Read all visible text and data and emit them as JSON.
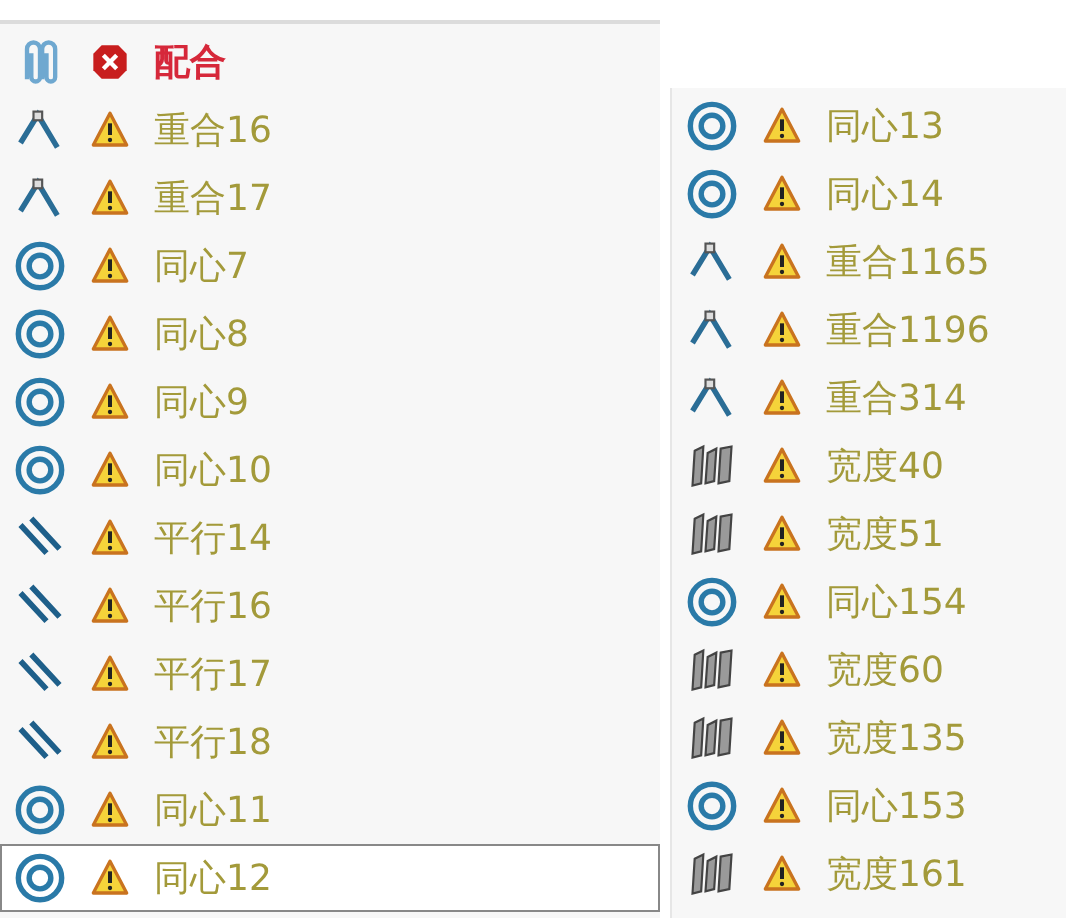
{
  "panels": [
    {
      "items": [
        {
          "kind": "mate",
          "error": true,
          "label": "配合",
          "selected": false
        },
        {
          "kind": "coincident",
          "error": false,
          "label": "重合16",
          "selected": false
        },
        {
          "kind": "coincident",
          "error": false,
          "label": "重合17",
          "selected": false
        },
        {
          "kind": "concentric",
          "error": false,
          "label": "同心7",
          "selected": false
        },
        {
          "kind": "concentric",
          "error": false,
          "label": "同心8",
          "selected": false
        },
        {
          "kind": "concentric",
          "error": false,
          "label": "同心9",
          "selected": false
        },
        {
          "kind": "concentric",
          "error": false,
          "label": "同心10",
          "selected": false
        },
        {
          "kind": "parallel",
          "error": false,
          "label": "平行14",
          "selected": false
        },
        {
          "kind": "parallel",
          "error": false,
          "label": "平行16",
          "selected": false
        },
        {
          "kind": "parallel",
          "error": false,
          "label": "平行17",
          "selected": false
        },
        {
          "kind": "parallel",
          "error": false,
          "label": "平行18",
          "selected": false
        },
        {
          "kind": "concentric",
          "error": false,
          "label": "同心11",
          "selected": false
        },
        {
          "kind": "concentric",
          "error": false,
          "label": "同心12",
          "selected": true
        }
      ]
    },
    {
      "items": [
        {
          "kind": "concentric",
          "error": false,
          "label": "同心13",
          "selected": false
        },
        {
          "kind": "concentric",
          "error": false,
          "label": "同心14",
          "selected": false
        },
        {
          "kind": "coincident",
          "error": false,
          "label": "重合1165",
          "selected": false
        },
        {
          "kind": "coincident",
          "error": false,
          "label": "重合1196",
          "selected": false
        },
        {
          "kind": "coincident",
          "error": false,
          "label": "重合314",
          "selected": false
        },
        {
          "kind": "width",
          "error": false,
          "label": "宽度40",
          "selected": false
        },
        {
          "kind": "width",
          "error": false,
          "label": "宽度51",
          "selected": false
        },
        {
          "kind": "concentric",
          "error": false,
          "label": "同心154",
          "selected": false
        },
        {
          "kind": "width",
          "error": false,
          "label": "宽度60",
          "selected": false
        },
        {
          "kind": "width",
          "error": false,
          "label": "宽度135",
          "selected": false
        },
        {
          "kind": "concentric",
          "error": false,
          "label": "同心153",
          "selected": false
        },
        {
          "kind": "width",
          "error": false,
          "label": "宽度161",
          "selected": false
        }
      ]
    }
  ]
}
